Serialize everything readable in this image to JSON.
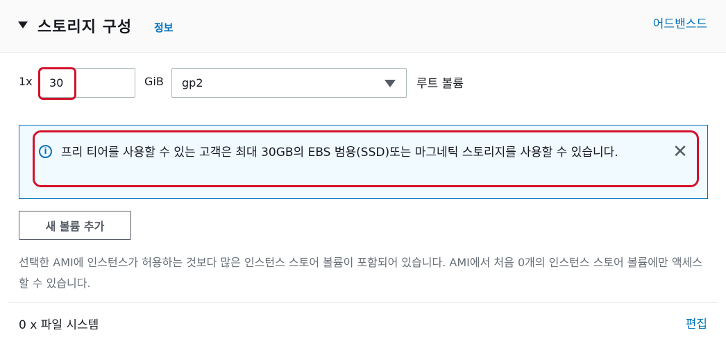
{
  "header": {
    "title": "스토리지 구성",
    "info_link": "정보",
    "advanced_link": "어드밴스드"
  },
  "volume": {
    "multiplier": "1x",
    "size_value": "30",
    "unit": "GiB",
    "volume_type": "gp2",
    "label": "루트 볼륨"
  },
  "alert": {
    "icon": "info-icon",
    "text": "프리 티어를 사용할 수 있는 고객은 최대 30GB의 EBS 범용(SSD)또는 마그네틱 스토리지를 사용할 수 있습니다."
  },
  "add_volume_button": "새 볼륨 추가",
  "note": "선택한 AMI에 인스턴스가 허용하는 것보다 많은 인스턴스 스토어 볼륨이 포함되어 있습니다. AMI에서 처음 0개의 인스턴스 스토어 볼륨에만 액세스할 수 있습니다.",
  "file_systems": {
    "label": "0 x 파일 시스템",
    "edit_link": "편집"
  },
  "colors": {
    "link": "#0073bb",
    "alert_bg": "#f1faff",
    "highlight": "#d5102a"
  }
}
